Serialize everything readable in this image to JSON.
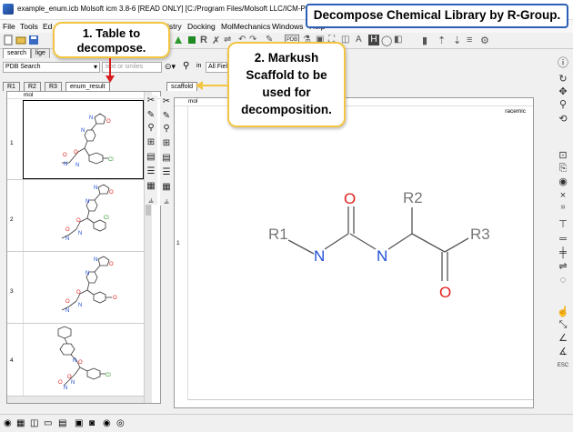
{
  "window": {
    "title": "example_enum.icb Molsoft icm 3.8-6 [READ ONLY]  [C:/Program Files/Molsoft LLC/ICM-Pro/",
    "banner": "Decompose Chemical Library by R-Group."
  },
  "menu": [
    "File",
    "Tools",
    "Ed",
    "istry",
    "Docking",
    "MolMechanics",
    "Windows",
    "Help"
  ],
  "toolbar": {
    "pdb_label": "PDB"
  },
  "search": {
    "database": "PDB Search",
    "smiles_placeholder": "text or smiles",
    "in_label": "in",
    "field": "All Fiel"
  },
  "top_tabs": [
    "search",
    "lige"
  ],
  "left_tabs": [
    "R1",
    "R2",
    "R3",
    "enum_result"
  ],
  "right_tabs": [
    "scaffold"
  ],
  "left_table": {
    "column": "mol",
    "rows": [
      "1",
      "2",
      "3",
      "4"
    ]
  },
  "right_table": {
    "column": "mol",
    "row": "1",
    "tag": "racemic"
  },
  "scaffold": {
    "r1": "R1",
    "r2": "R2",
    "r3": "R3",
    "o_top": "O",
    "o_bottom": "O",
    "n_left": "N",
    "n_right": "N"
  },
  "callouts": {
    "table": "1. Table to decompose.",
    "scaffold": "2. Markush Scaffold to be used for decomposition."
  },
  "colors": {
    "nitrogen": "#1f4fd6",
    "oxygen": "#e0201d",
    "carbon_bond": "#555555",
    "rgroup": "#777777",
    "callout_border": "#f4c542",
    "arrow_red": "#d81e1e",
    "arrow_yellow": "#f4c542",
    "banner_border": "#2c5fb5"
  }
}
